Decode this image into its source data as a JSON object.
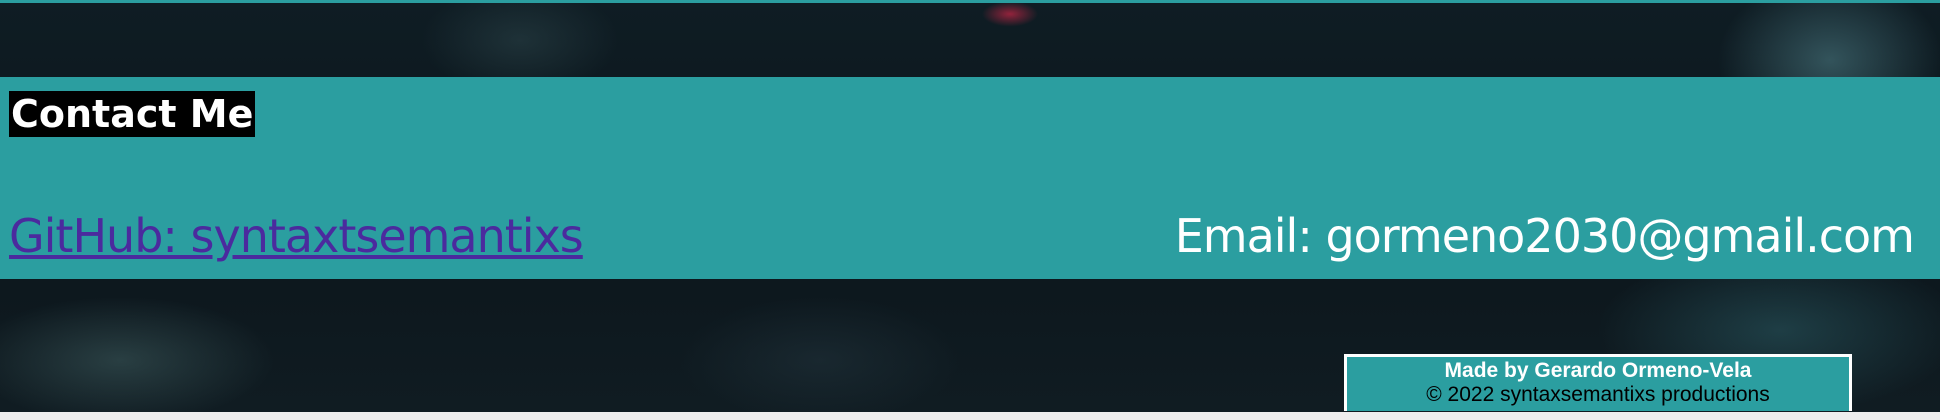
{
  "contact": {
    "heading": "Contact Me",
    "github_label": "GitHub: syntaxtsemantixs",
    "email_label": "Email: gormeno2030@gmail.com"
  },
  "footer": {
    "credit": "Made by Gerardo Ormeno-Vela",
    "copyright": "© 2022 syntaxsemantixs productions"
  },
  "colors": {
    "band": "#2b9ea0",
    "heading_bg": "#000000",
    "link": "#4b2a9e",
    "text_light": "#ffffff"
  }
}
